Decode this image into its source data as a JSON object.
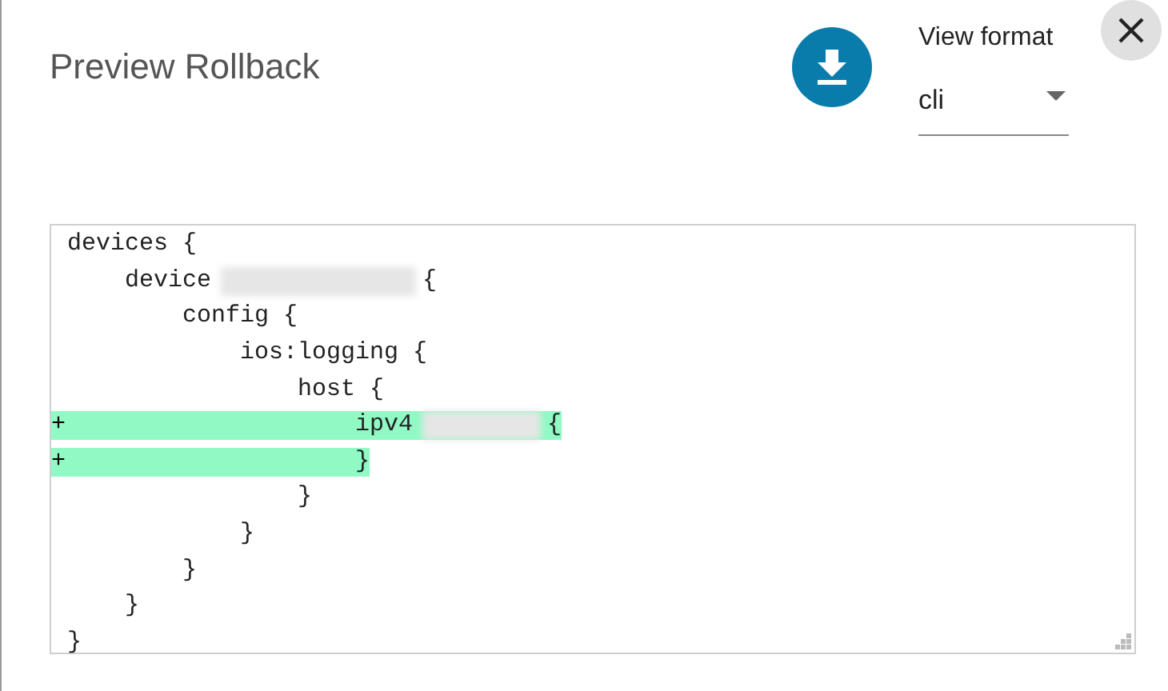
{
  "dialog": {
    "title": "Preview Rollback"
  },
  "view_format": {
    "label": "View format",
    "value": "cli"
  },
  "diff_lines": [
    {
      "added": false,
      "text": "devices {",
      "redacted": false
    },
    {
      "added": false,
      "text": "    device",
      "redacted": true,
      "tail": "{"
    },
    {
      "added": false,
      "text": "        config {",
      "redacted": false
    },
    {
      "added": false,
      "text": "            ios:logging {",
      "redacted": false
    },
    {
      "added": false,
      "text": "                host {",
      "redacted": false
    },
    {
      "added": true,
      "prefix": "+",
      "text": "                    ipv4",
      "redacted": true,
      "tail": "{"
    },
    {
      "added": true,
      "prefix": "+",
      "text": "                    }",
      "redacted": false
    },
    {
      "added": false,
      "text": "                }",
      "redacted": false
    },
    {
      "added": false,
      "text": "            }",
      "redacted": false
    },
    {
      "added": false,
      "text": "        }",
      "redacted": false
    },
    {
      "added": false,
      "text": "    }",
      "redacted": false
    },
    {
      "added": false,
      "text": "}",
      "redacted": false
    }
  ]
}
